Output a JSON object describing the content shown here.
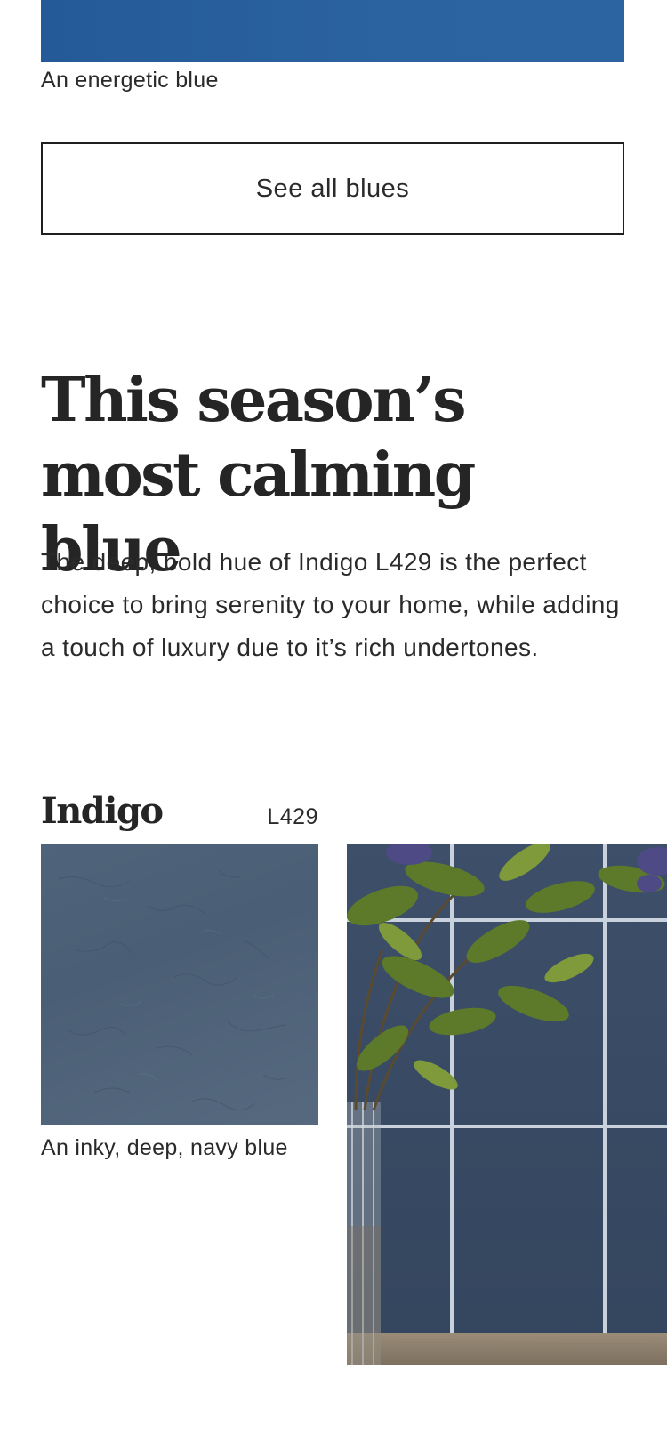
{
  "previous_card": {
    "color": "#2a62a0",
    "caption": "An energetic blue"
  },
  "see_all_button": {
    "label": "See all blues"
  },
  "feature": {
    "headline": "This season’s most calming blue",
    "body": "The deep, bold hue of Indigo L429 is the perfect choice to bring serenity to your home, while adding a touch of luxury due to it’s rich undertones."
  },
  "color_card": {
    "name": "Indigo",
    "code": "L429",
    "color": "#4e6279",
    "caption": "An inky, deep, navy blue"
  },
  "lifestyle_image": {
    "icon": "room-photo-icon"
  }
}
